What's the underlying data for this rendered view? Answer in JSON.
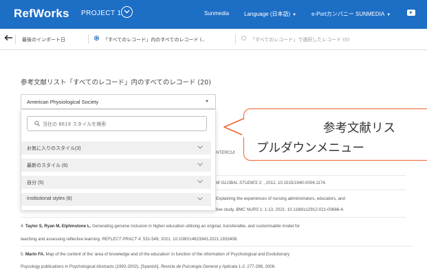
{
  "header": {
    "brand": "RefWorks",
    "project": "PROJECT 1",
    "user": "Sunmedia",
    "language": "Language (日本語)",
    "organization": "e-Portカンパニー SUNMEDIA",
    "colors": {
      "header_bg": "#1d6ec5",
      "accent": "#f0612c"
    }
  },
  "toolbar": {
    "last_import": "最後のインポート日",
    "option_all": "「すべてのレコード」内のすべてのレコード (..",
    "option_selected": "「すべてのレコード」で選択したレコード (0)"
  },
  "main": {
    "list_title": "参考文献リスト「すべてのレコード」内のすべてのレコード (20)",
    "style_select": {
      "value": "American Physiological Society"
    },
    "dropdown": {
      "search_placeholder": "当社の 6619 スタイルを検索",
      "groups": [
        "お気に入りのスタイル(3)",
        "最新のスタイル (6)",
        "自分 (5)",
        "Institutional styles (8)"
      ]
    },
    "references": {
      "r1_tail": "NTERCUI",
      "r2_tail_journal": "W GLOBAL STUDIES",
      "r2_tail_rest": " 2: , 2012. 10.1515/1940-0004.1174.",
      "r3_tail_line1": "Explaining the experiences of nursing administrators, educators, and",
      "r3_tail_line2_a": "tive study. ",
      "r3_tail_line2_journal": "BMC NURS",
      "r3_tail_line2_b": " 1: 1-13, 2021. 10.1186/s12912-021-00666-4.",
      "r4_num": "4. ",
      "r4_authors": "Taylor S, Ryan M, Elphinstone L.",
      "r4_text": " Generating genuine inclusion in higher education utilising an original, transferable, and customisable model for",
      "r4_line2_a": "teaching and assessing reflective learning. ",
      "r4_line2_journal": "REFLECT PRACT",
      "r4_line2_b": " 4: 531-549, 2021. 10.1080/14623943.2021.1933408.",
      "r5_num": "5. ",
      "r5_authors": "Marin FA.",
      "r5_text": " Map of the content of the 'area of knowledge and of the education' in function of the information of Psychological and Evolutionary",
      "r5_line2_a": "Psycology publications in Psychological Abstracts (1992-2002). [Spanish]. ",
      "r5_line2_journal": "Revista de Psicologia General y Aplicata",
      "r5_line2_b": " 1-2: 277-296, 2006."
    }
  },
  "callout": {
    "line1": "参考文献リス",
    "line2": "プルダウンメニュー"
  }
}
